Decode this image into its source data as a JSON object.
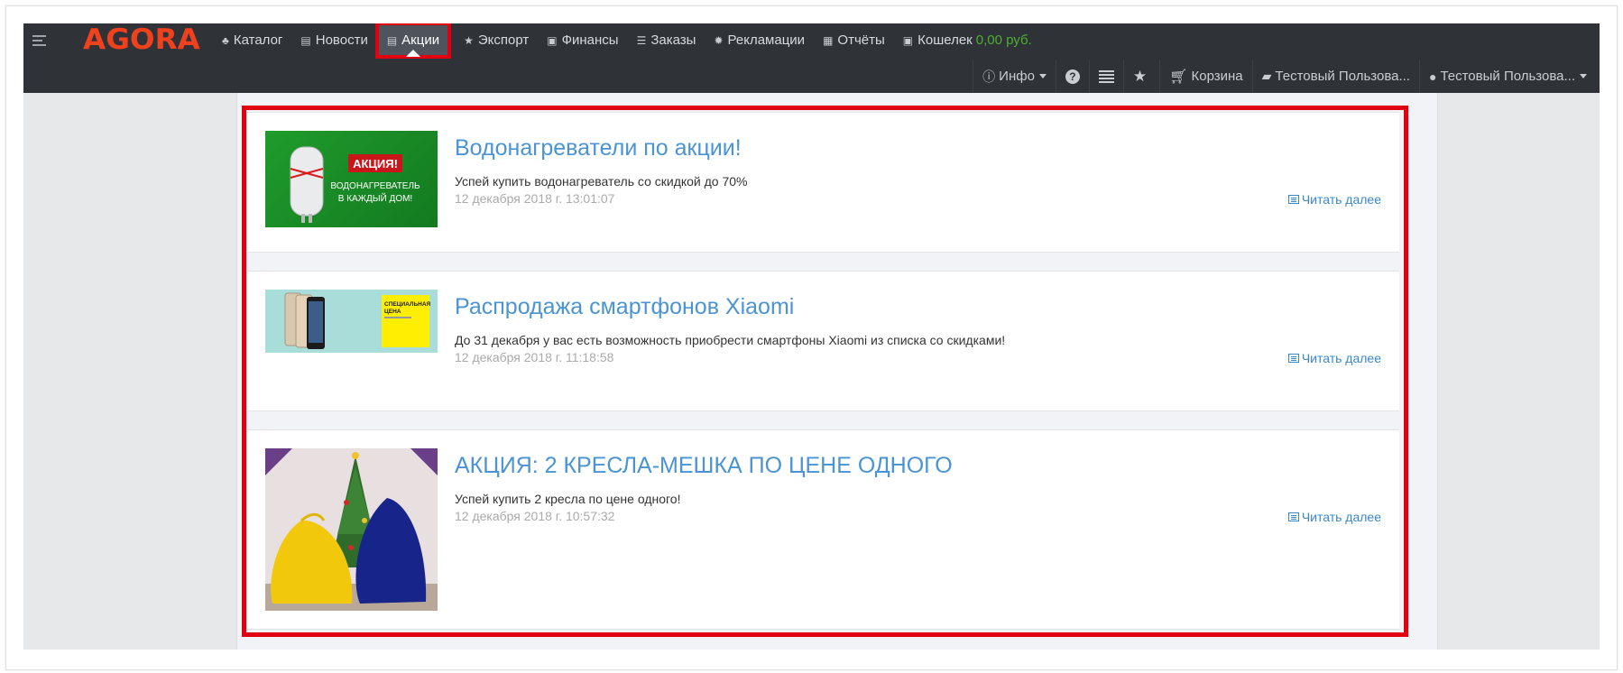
{
  "logo": "AGORA",
  "nav": {
    "menu": [
      {
        "icon": "sitemap-icon",
        "glyph": "♣",
        "label": "Каталог"
      },
      {
        "icon": "document-icon",
        "glyph": "▤",
        "label": "Новости"
      },
      {
        "icon": "document-icon",
        "glyph": "▤",
        "label": "Акции",
        "active": true
      },
      {
        "icon": "star-icon",
        "glyph": "★",
        "label": "Экспорт"
      },
      {
        "icon": "money-icon",
        "glyph": "▣",
        "label": "Финансы"
      },
      {
        "icon": "tasks-icon",
        "glyph": "☰",
        "label": "Заказы"
      },
      {
        "icon": "certificate-icon",
        "glyph": "✹",
        "label": "Рекламации"
      },
      {
        "icon": "table-icon",
        "glyph": "▦",
        "label": "Отчёты"
      }
    ],
    "wallet": {
      "icon": "money-icon",
      "label": "Кошелек",
      "value": "0,00 руб.",
      "value_color": "#4caf32"
    },
    "secondary": {
      "info": "Инфо",
      "cart": "Корзина",
      "company": "Тестовый Пользова...",
      "user": "Тестовый Пользова..."
    }
  },
  "promotions": [
    {
      "title": "Водонагреватели по акции!",
      "description": "Успей купить водонагреватель со скидкой до 70%",
      "date": "12 декабря 2018 г. 13:01:07",
      "read_more": "Читать далее",
      "image": {
        "badge": "АКЦИЯ!",
        "line1": "ВОДОНАГРЕВАТЕЛЬ",
        "line2": "В КАЖДЫЙ ДОМ!"
      }
    },
    {
      "title": "Распродажа смартфонов Xiaomi",
      "description": "До 31 декабря у вас есть возможность приобрести смартфоны Xiaomi из списка со скидками!",
      "date": "12 декабря 2018 г. 11:18:58",
      "read_more": "Читать далее",
      "image": {
        "line1": "СПЕЦИАЛЬНАЯ",
        "line2": "ЦЕНА"
      }
    },
    {
      "title": "АКЦИЯ: 2 КРЕСЛА-МЕШКА ПО ЦЕНЕ ОДНОГО",
      "description": "Успей купить 2 кресла по цене одного!",
      "date": "12 декабря 2018 г. 10:57:32",
      "read_more": "Читать далее"
    }
  ],
  "colors": {
    "accent": "#4a94d3",
    "highlight": "#e00010",
    "navbar": "#2f3237",
    "logo": "#f0411f"
  }
}
